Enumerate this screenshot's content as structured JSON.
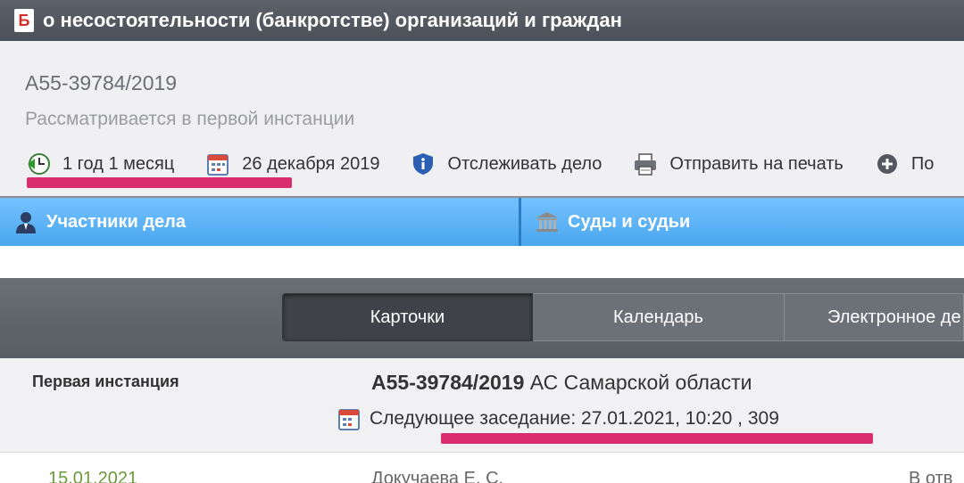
{
  "header": {
    "badge": "Б",
    "title": "о несостоятельности (банкротстве) организаций и граждан"
  },
  "case": {
    "number": "А55-39784/2019",
    "status": "Рассматривается в первой инстанции",
    "meta": {
      "duration": "1 год 1 месяц",
      "date": "26 декабря 2019",
      "track": "Отслеживать дело",
      "print": "Отправить на печать",
      "more": "По"
    }
  },
  "tabs": {
    "participants": "Участники дела",
    "courts": "Суды и судьи"
  },
  "view_tabs": {
    "cards": "Карточки",
    "calendar": "Календарь",
    "electronic": "Электронное де"
  },
  "instance": {
    "label": "Первая инстанция",
    "case_number": "А55-39784/2019",
    "court": "АС Самарской области",
    "next_hearing": "Следующее заседание: 27.01.2021, 10:20 , 309"
  },
  "row": {
    "date": "15.01.2021",
    "judge": "Докучаева Е. С.",
    "status": "В отв"
  },
  "colors": {
    "accent_underline": "#d92e6d",
    "tab_blue": "#4aa6ee",
    "header_dark": "#50545b"
  }
}
